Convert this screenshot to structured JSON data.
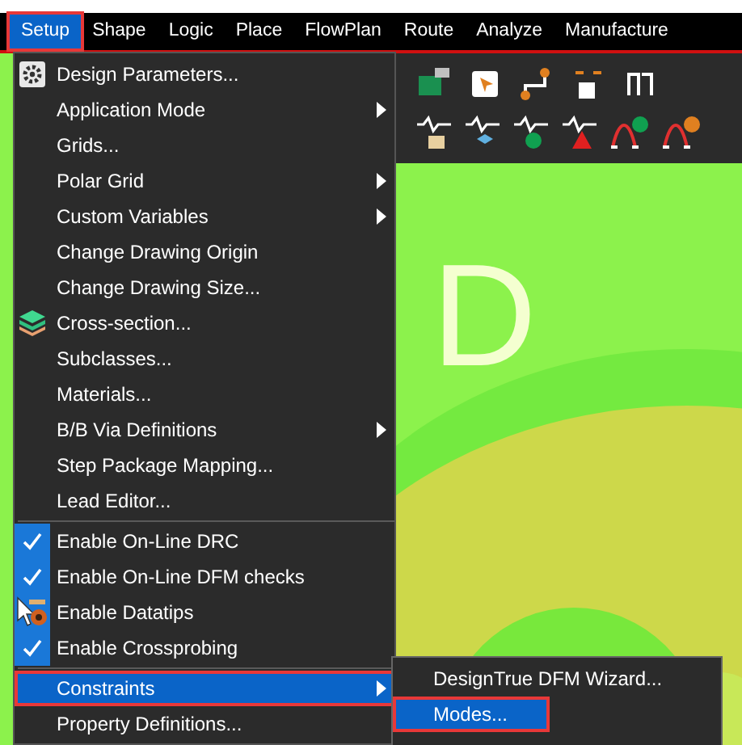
{
  "menubar": [
    {
      "label": "Setup",
      "selected": true,
      "outlined": true
    },
    {
      "label": "Shape",
      "selected": false,
      "outlined": false
    },
    {
      "label": "Logic",
      "selected": false,
      "outlined": false
    },
    {
      "label": "Place",
      "selected": false,
      "outlined": false
    },
    {
      "label": "FlowPlan",
      "selected": false,
      "outlined": false
    },
    {
      "label": "Route",
      "selected": false,
      "outlined": false
    },
    {
      "label": "Analyze",
      "selected": false,
      "outlined": false
    },
    {
      "label": "Manufacture",
      "selected": false,
      "outlined": false
    }
  ],
  "setup_menu": [
    {
      "kind": "gear",
      "label": "Design Parameters...",
      "checked": false,
      "submenu": false,
      "selected": false,
      "outlined": false
    },
    {
      "kind": "item",
      "label": "Application Mode",
      "checked": false,
      "submenu": true,
      "selected": false,
      "outlined": false
    },
    {
      "kind": "item",
      "label": "Grids...",
      "checked": false,
      "submenu": false,
      "selected": false,
      "outlined": false
    },
    {
      "kind": "item",
      "label": "Polar Grid",
      "checked": false,
      "submenu": true,
      "selected": false,
      "outlined": false
    },
    {
      "kind": "item",
      "label": "Custom Variables",
      "checked": false,
      "submenu": true,
      "selected": false,
      "outlined": false
    },
    {
      "kind": "item",
      "label": "Change Drawing Origin",
      "checked": false,
      "submenu": false,
      "selected": false,
      "outlined": false
    },
    {
      "kind": "item",
      "label": "Change Drawing Size...",
      "checked": false,
      "submenu": false,
      "selected": false,
      "outlined": false
    },
    {
      "kind": "layers",
      "label": "Cross-section...",
      "checked": false,
      "submenu": false,
      "selected": false,
      "outlined": false
    },
    {
      "kind": "item",
      "label": "Subclasses...",
      "checked": false,
      "submenu": false,
      "selected": false,
      "outlined": false
    },
    {
      "kind": "item",
      "label": "Materials...",
      "checked": false,
      "submenu": false,
      "selected": false,
      "outlined": false
    },
    {
      "kind": "item",
      "label": "B/B Via Definitions",
      "checked": false,
      "submenu": true,
      "selected": false,
      "outlined": false
    },
    {
      "kind": "item",
      "label": "Step Package Mapping...",
      "checked": false,
      "submenu": false,
      "selected": false,
      "outlined": false
    },
    {
      "kind": "item",
      "label": "Lead Editor...",
      "checked": false,
      "submenu": false,
      "selected": false,
      "outlined": false
    },
    {
      "kind": "separator"
    },
    {
      "kind": "item",
      "label": "Enable On-Line DRC",
      "checked": true,
      "submenu": false,
      "selected": false,
      "outlined": false
    },
    {
      "kind": "item",
      "label": "Enable On-Line DFM checks",
      "checked": true,
      "submenu": false,
      "selected": false,
      "outlined": false
    },
    {
      "kind": "datatips",
      "label": "Enable Datatips",
      "checked": true,
      "submenu": false,
      "selected": false,
      "outlined": false
    },
    {
      "kind": "item",
      "label": "Enable Crossprobing",
      "checked": true,
      "submenu": false,
      "selected": false,
      "outlined": false
    },
    {
      "kind": "separator"
    },
    {
      "kind": "item",
      "label": "Constraints",
      "checked": false,
      "submenu": true,
      "selected": true,
      "outlined": true
    },
    {
      "kind": "item",
      "label": "Property Definitions...",
      "checked": false,
      "submenu": false,
      "selected": false,
      "outlined": false
    }
  ],
  "constraints_submenu": [
    {
      "label": "DesignTrue DFM Wizard...",
      "selected": false,
      "outlined": false
    },
    {
      "label": "Modes...",
      "selected": true,
      "outlined": true
    }
  ],
  "canvas_label": "D"
}
